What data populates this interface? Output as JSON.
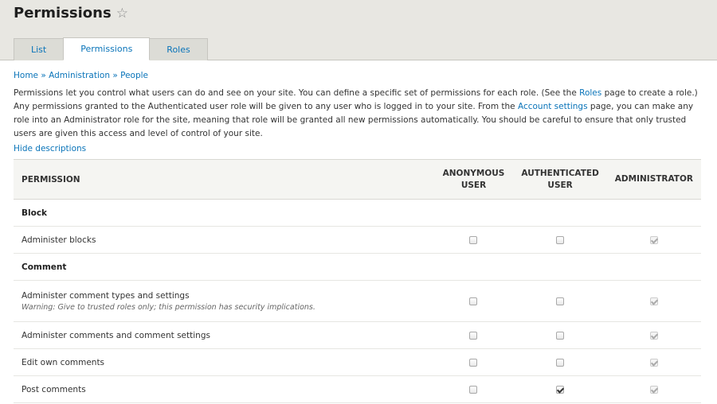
{
  "header": {
    "title": "Permissions",
    "star_icon": "star-outline-icon",
    "tabs": [
      {
        "label": "List",
        "active": false
      },
      {
        "label": "Permissions",
        "active": true
      },
      {
        "label": "Roles",
        "active": false
      }
    ]
  },
  "breadcrumb": {
    "items": [
      "Home",
      "Administration",
      "People"
    ],
    "separator": "»"
  },
  "intro": {
    "part1": "Permissions let you control what users can do and see on your site. You can define a specific set of permissions for each role. (See the ",
    "roles_link": "Roles",
    "part2": " page to create a role.) Any permissions granted to the Authenticated user role will be given to any user who is logged in to your site. From the ",
    "account_link": "Account settings",
    "part3": " page, you can make any role into an Administrator role for the site, meaning that role will be granted all new permissions automatically. You should be careful to ensure that only trusted users are given this access and level of control of your site."
  },
  "hide_descriptions": "Hide descriptions",
  "table": {
    "headers": {
      "permission": "PERMISSION",
      "anonymous_line1": "ANONYMOUS",
      "anonymous_line2": "USER",
      "authenticated_line1": "AUTHENTICATED",
      "authenticated_line2": "USER",
      "administrator": "ADMINISTRATOR"
    },
    "modules": [
      {
        "name": "Block",
        "permissions": [
          {
            "label": "Administer blocks",
            "warning": "",
            "anonymous": false,
            "authenticated": false,
            "administrator": true
          }
        ]
      },
      {
        "name": "Comment",
        "permissions": [
          {
            "label": "Administer comment types and settings",
            "warning": "Warning: Give to trusted roles only; this permission has security implications.",
            "anonymous": false,
            "authenticated": false,
            "administrator": true
          },
          {
            "label": "Administer comments and comment settings",
            "warning": "",
            "anonymous": false,
            "authenticated": false,
            "administrator": true
          },
          {
            "label": "Edit own comments",
            "warning": "",
            "anonymous": false,
            "authenticated": false,
            "administrator": true
          },
          {
            "label": "Post comments",
            "warning": "",
            "anonymous": false,
            "authenticated": true,
            "administrator": true
          }
        ]
      }
    ]
  }
}
